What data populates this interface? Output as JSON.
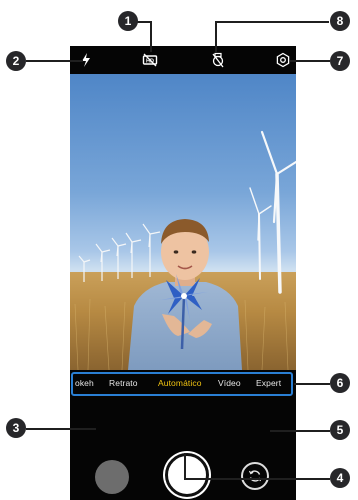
{
  "camera": {
    "modes": [
      {
        "label": "okeh",
        "active": false
      },
      {
        "label": "Retrato",
        "active": false
      },
      {
        "label": "Automático",
        "active": true
      },
      {
        "label": "Vídeo",
        "active": false
      },
      {
        "label": "Expert",
        "active": false
      }
    ],
    "accent_color": "#f2c311",
    "highlight_color": "#2a7fd4"
  },
  "toolbar": {
    "icons": [
      "flash-icon",
      "hdr-off-icon",
      "ai-camera-off-icon",
      "settings-icon"
    ]
  },
  "bottom": {
    "icons": [
      "gallery-thumbnail",
      "shutter-button",
      "switch-camera-icon"
    ]
  },
  "callouts": {
    "c1": "1",
    "c2": "2",
    "c3": "3",
    "c4": "4",
    "c5": "5",
    "c6": "6",
    "c7": "7",
    "c8": "8"
  }
}
